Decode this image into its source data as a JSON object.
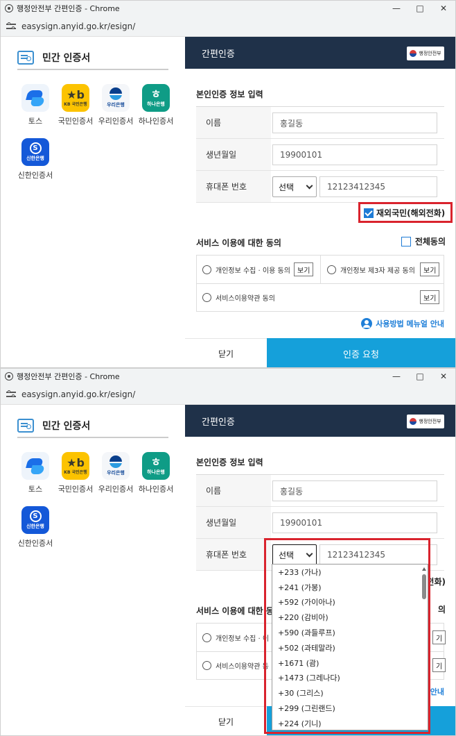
{
  "window": {
    "title": "행정안전부 간편인증 - Chrome",
    "url": "easysign.anyid.go.kr/esign/"
  },
  "left": {
    "title": "민간 인증서",
    "apps": [
      {
        "label": "토스"
      },
      {
        "label": "국민인증서",
        "icon_text": "KB 국민은행"
      },
      {
        "label": "우리인증서",
        "icon_text": "우리은행"
      },
      {
        "label": "하나인증서",
        "icon_text": "하나은행"
      },
      {
        "label": "신한인증서",
        "icon_text": "신한은행"
      }
    ]
  },
  "right": {
    "header": "간편인증",
    "gov_logo": "행정안전부",
    "section1": "본인인증 정보 입력",
    "name_label": "이름",
    "name_placeholder": "홍길동",
    "birth_label": "생년월일",
    "birth_placeholder": "19900101",
    "phone_label": "휴대폰 번호",
    "phone_select": "선택",
    "phone_placeholder": "12123412345",
    "overseas_label": "재외국민(해외전화)",
    "overseas_checked": true,
    "section2": "서비스 이용에 대한 동의",
    "agree_all": "전체동의",
    "agree1": "개인정보 수집 · 이용 동의",
    "agree2": "개인정보 제3자 제공 동의",
    "agree3": "서비스이용약관 동의",
    "view_label": "보기",
    "manual": "사용방법 메뉴얼 안내",
    "close": "닫기",
    "request": "인증 요청"
  },
  "second": {
    "overseas_partial": "전화)",
    "section2_partial": "서비스 이용에 대한 동",
    "agree_all_partial": "의",
    "agree1_partial": "개인정보 수집 · 이",
    "agree3_partial": "서비스이용약관 동",
    "view_partial": "기",
    "manual_partial": "안내"
  },
  "dropdown_options": [
    "+233 (가나)",
    "+241 (가봉)",
    "+592 (가이아나)",
    "+220 (감비아)",
    "+590 (과들루프)",
    "+502 (과테말라)",
    "+1671 (괌)",
    "+1473 (그레나다)",
    "+30 (그리스)",
    "+299 (그린랜드)",
    "+224 (기니)"
  ],
  "colors": {
    "header_bg": "#1f3149",
    "request_bg": "#15a0da",
    "highlight": "#d9232d",
    "link": "#1f7fd8"
  }
}
